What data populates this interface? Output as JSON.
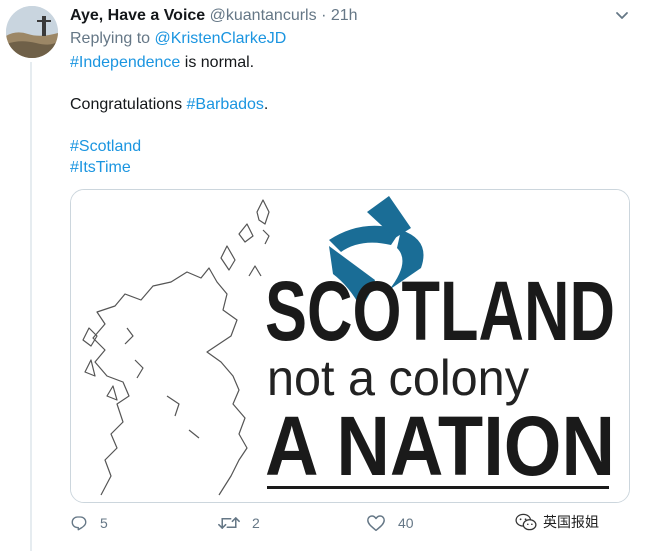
{
  "tweet": {
    "author_name": "Aye, Have a Voice",
    "handle": "@kuantancurls",
    "separator": "·",
    "time": "21h",
    "replying_prefix": "Replying to",
    "replying_to": "@KristenClarkeJD",
    "line1_hashtag": "#Independence",
    "line1_rest": " is normal.",
    "line2_text": "Congratulations ",
    "line2_hashtag": "#Barbados",
    "line2_end": ".",
    "hashtag3": "#Scotland",
    "hashtag4": "#ItsTime"
  },
  "image": {
    "headline": "SCOTLAND",
    "subline": "not a colony",
    "tagline": "A NATION",
    "saltire_color": "#1a6d96"
  },
  "actions": {
    "reply_count": "5",
    "retweet_count": "2",
    "like_count": "40"
  },
  "watermark": {
    "text": "英国报姐"
  },
  "colors": {
    "link": "#1b95e0",
    "muted": "#657786"
  }
}
